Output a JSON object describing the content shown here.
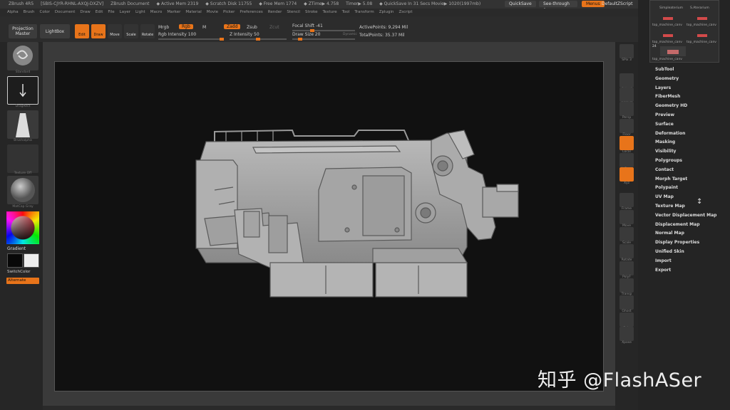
{
  "title_bar": {
    "app": "ZBrush 4R5",
    "serial": "[SBIS-CJYR-RHNL-AXQJ-DXZV]",
    "document": "ZBrush Document",
    "active_mem": "◆ Active Mem 2319",
    "scratch_disk": "◆ Scratch Disk 11755",
    "free_mem": "◆ Free Mem 1774",
    "ztime": "◆ ZTime▶ 4.758",
    "timer": "Timer▶ 5.08",
    "quicksave_info": "◆ QuickSave In 31 Secs Movie▶ 1020(1997mb)",
    "quicksave_btn": "QuickSave",
    "see_through": "See-through 0",
    "menus_btn": "Menus",
    "default_zscript": "DefaultZScript"
  },
  "menubar": [
    "Alpha",
    "Brush",
    "Color",
    "Document",
    "Draw",
    "Edit",
    "File",
    "Layer",
    "Light",
    "Macro",
    "Marker",
    "Material",
    "Movie",
    "Picker",
    "Preferences",
    "Render",
    "Stencil",
    "Stroke",
    "Texture",
    "Tool",
    "Transform",
    "Zplugin",
    "Zscript"
  ],
  "toolbar": {
    "projection_master": "Projection Master",
    "lightbox": "LightBox",
    "edit": "Edit",
    "draw": "Draw",
    "move": "Move",
    "scale": "Scale",
    "rotate": "Rotate",
    "mrgb": "Mrgb",
    "rgb": "Rgb",
    "m": "M",
    "zadd": "Zadd",
    "zsub": "Zsub",
    "zcut": "Zcut",
    "rgb_intensity": "Rgb Intensity 100",
    "z_intensity": "Z Intensity 50",
    "focal_shift": "Focal Shift -41",
    "draw_size": "Draw Size 20",
    "dynamic": "Dynamic",
    "active_points": "ActivePoints: 9,294 Mil",
    "total_points": "TotalPoints: 35.37 Mil",
    "rgb_intensity_level": 1.0,
    "z_intensity_level": 0.5,
    "focal_shift_level": 0.3,
    "draw_size_level": 0.1
  },
  "left_panel": {
    "material_cap": "Standard",
    "stroke_cap": "DragRect",
    "alpha_cap": "Brushalpha",
    "texture_cap": "Texture Off",
    "matcap_cap": "MatCap Gray",
    "gradient": "Gradient",
    "switch_color": "SwitchColor",
    "alternate": "Alternate"
  },
  "right_shelf": [
    "SPix 3",
    "Actual",
    "AAHalf",
    "Persp",
    "Floor",
    "Local",
    "L.Sym",
    "Xyz",
    "Frame",
    "Move",
    "Scale",
    "Rotate",
    "PolyF",
    "Transp",
    "Ghost",
    "Solo",
    "Xpose"
  ],
  "subtool_popup": {
    "names": [
      "Simpleaterium",
      "S.Aterarium",
      "top_machine_canv",
      "top_machine_canv",
      "top_machine_canv",
      "top_machine_canv",
      "top_machine_canv"
    ],
    "count_label": "24"
  },
  "tool_palette": [
    "SubTool",
    "Geometry",
    "Layers",
    "FiberMesh",
    "Geometry HD",
    "Preview",
    "Surface",
    "Deformation",
    "Masking",
    "Visibility",
    "Polygroups",
    "Contact",
    "Morph Target",
    "Polypaint",
    "UV Map",
    "Texture Map",
    "Vector Displacement Map",
    "Displacement Map",
    "Normal Map",
    "Display Properties",
    "Unified Skin",
    "Import",
    "Export"
  ],
  "watermark": "知乎 @FlashASer",
  "colors": {
    "accent": "#e8741a",
    "bg": "#262626",
    "canvas": "#111111"
  }
}
